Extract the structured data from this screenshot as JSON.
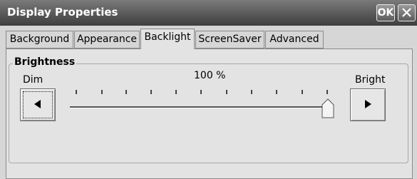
{
  "window": {
    "title": "Display Properties",
    "ok_label": "OK",
    "close_icon": "close-icon"
  },
  "tabs": [
    {
      "label": "Background"
    },
    {
      "label": "Appearance"
    },
    {
      "label": "Backlight",
      "active": true
    },
    {
      "label": "ScreenSaver"
    },
    {
      "label": "Advanced"
    }
  ],
  "brightness": {
    "group_label": "Brightness",
    "dim_label": "Dim",
    "bright_label": "Bright",
    "percent_text": "100 %",
    "value_fraction": 1.0,
    "decrease_icon": "left-arrow-icon",
    "increase_icon": "right-arrow-icon"
  }
}
